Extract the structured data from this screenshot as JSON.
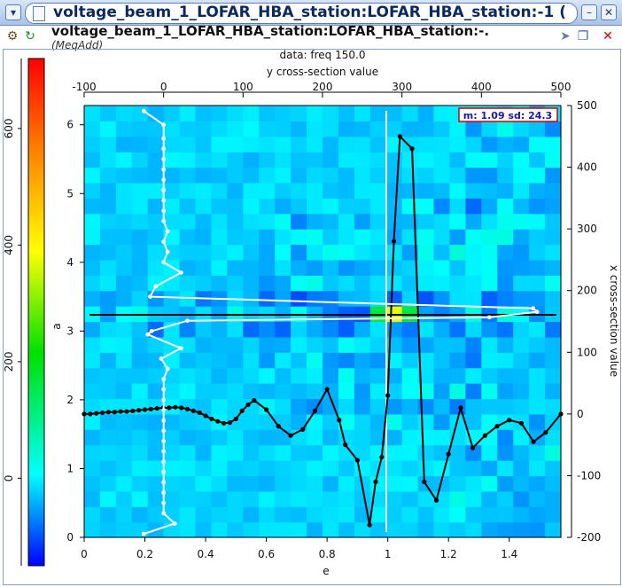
{
  "window": {
    "title": "voltage_beam_1_LOFAR_HBA_station:LOFAR_HBA_station:-1 (",
    "doc_title": "voltage_beam_1_LOFAR_HBA_station:LOFAR_HBA_station:-.",
    "doc_subtitle": "(MeqAdd)"
  },
  "icons": [
    "window-menu-icon",
    "gears-icon",
    "refresh-icon",
    "pin-icon",
    "float-icon",
    "close-icon"
  ],
  "colors": {
    "white_curve": "#ffffff",
    "black_curve": "#000000",
    "stats_border": "#d40000",
    "stats_text": "#1a1aa8"
  },
  "plot": {
    "data_label": "data: freq 150.0",
    "top_axis_label": "y cross-section value",
    "bottom_axis_label": "e",
    "left_axis_label": "a",
    "right_axis_label": "x cross-section value",
    "stats_box": "m: 1.09 sd: 24.3",
    "colorbar_ticks": [
      "0",
      "200",
      "400",
      "600"
    ],
    "top_ticks": [
      "-100",
      "0",
      "100",
      "200",
      "300",
      "400",
      "500"
    ],
    "bottom_ticks": [
      "0",
      "0.2",
      "0.4",
      "0.6",
      "0.8",
      "1",
      "1.2",
      "1.4"
    ],
    "left_ticks": [
      "0",
      "1",
      "2",
      "3",
      "4",
      "5",
      "6"
    ],
    "right_ticks": [
      "-200",
      "-100",
      "0",
      "100",
      "200",
      "300",
      "400",
      "500"
    ]
  },
  "chart_data": {
    "type": "heatmap",
    "title": "data: freq 150.0",
    "xlabel": "e",
    "ylabel": "a",
    "xlim": [
      0,
      1.57
    ],
    "ylim": [
      0,
      6.28
    ],
    "colorbar_range": [
      -150,
      720
    ],
    "crosshair": {
      "x": 1.0,
      "y": 3.21
    },
    "peak": {
      "x": 1.0,
      "y": 3.14
    },
    "x_cross_section": {
      "axis_range": [
        -200,
        500
      ],
      "x": [
        0,
        0.02,
        0.04,
        0.06,
        0.08,
        0.1,
        0.12,
        0.14,
        0.16,
        0.18,
        0.2,
        0.22,
        0.24,
        0.26,
        0.28,
        0.3,
        0.32,
        0.34,
        0.36,
        0.38,
        0.4,
        0.42,
        0.44,
        0.46,
        0.48,
        0.5,
        0.52,
        0.54,
        0.56,
        0.6,
        0.64,
        0.68,
        0.72,
        0.76,
        0.8,
        0.84,
        0.86,
        0.9,
        0.94,
        0.96,
        0.98,
        1.0,
        1.02,
        1.04,
        1.08,
        1.12,
        1.16,
        1.2,
        1.24,
        1.28,
        1.32,
        1.36,
        1.4,
        1.44,
        1.48,
        1.52,
        1.57
      ],
      "values": [
        0,
        0,
        1,
        2,
        3,
        3,
        4,
        4,
        5,
        6,
        7,
        8,
        9,
        10,
        10,
        11,
        10,
        8,
        5,
        2,
        -3,
        -8,
        -12,
        -15,
        -14,
        -8,
        5,
        15,
        22,
        7,
        -20,
        -35,
        -25,
        5,
        40,
        -10,
        -50,
        -75,
        -180,
        -110,
        -70,
        30,
        280,
        450,
        430,
        -110,
        -140,
        -65,
        10,
        -55,
        -35,
        -20,
        -10,
        -15,
        -45,
        -30,
        0
      ]
    },
    "y_cross_section": {
      "axis_range": [
        -100,
        500
      ],
      "y": [
        0.05,
        0.2,
        0.35,
        0.5,
        0.65,
        0.8,
        0.95,
        1.1,
        1.25,
        1.4,
        1.55,
        1.7,
        1.85,
        2.0,
        2.15,
        2.3,
        2.45,
        2.6,
        2.75,
        2.95,
        3.0,
        3.15,
        3.2,
        3.28,
        3.33,
        3.5,
        3.65,
        3.85,
        4.0,
        4.15,
        4.3,
        4.45,
        4.6,
        4.75,
        4.9,
        5.05,
        5.2,
        5.35,
        5.5,
        5.65,
        5.8,
        6.0,
        6.2
      ],
      "values": [
        -25,
        14,
        0,
        0,
        0,
        0,
        0,
        0,
        0,
        0,
        0,
        0,
        0,
        0,
        0,
        0,
        5,
        -3,
        22,
        -20,
        -15,
        30,
        410,
        470,
        465,
        -17,
        -10,
        22,
        0,
        5,
        0,
        5,
        0,
        0,
        0,
        0,
        0,
        0,
        0,
        0,
        0,
        0,
        -25
      ]
    }
  }
}
